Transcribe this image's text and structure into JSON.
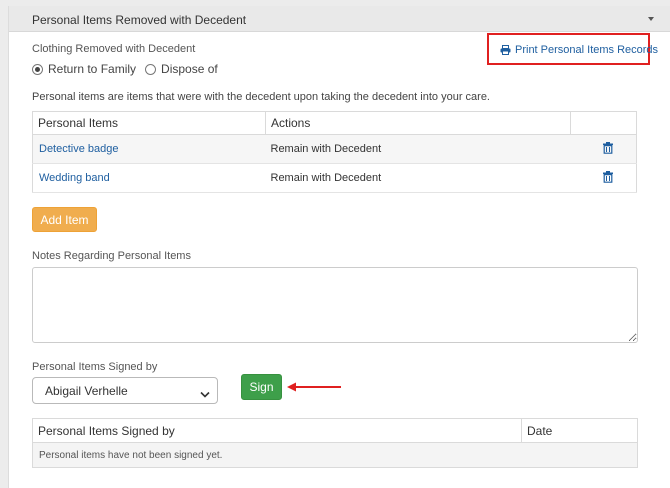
{
  "panel": {
    "title": "Personal Items Removed with Decedent"
  },
  "clothing": {
    "label": "Clothing Removed with Decedent",
    "options": [
      {
        "label": "Return to Family",
        "selected": true
      },
      {
        "label": "Dispose of",
        "selected": false
      }
    ]
  },
  "print": {
    "label": "Print Personal Items Records",
    "icon": "printer-icon"
  },
  "description": "Personal items are items that were with the decedent upon taking the decedent into your care.",
  "items_table": {
    "headers": [
      "Personal Items",
      "Actions",
      ""
    ],
    "rows": [
      {
        "item": "Detective badge",
        "action": "Remain with Decedent",
        "icon": "trash-icon"
      },
      {
        "item": "Wedding band",
        "action": "Remain with Decedent",
        "icon": "trash-icon"
      }
    ]
  },
  "add_item_label": "Add Item",
  "notes": {
    "label": "Notes Regarding Personal Items",
    "value": ""
  },
  "signed_by": {
    "label": "Personal Items Signed by",
    "selected": "Abigail Verhelle",
    "sign_label": "Sign"
  },
  "signed_table": {
    "headers": [
      "Personal Items Signed by",
      "Date"
    ],
    "empty_message": "Personal items have not been signed yet."
  },
  "colors": {
    "link": "#1f5fa0",
    "add_button": "#f0ad4e",
    "sign_button": "#3e9f4a",
    "highlight": "#e02020"
  }
}
